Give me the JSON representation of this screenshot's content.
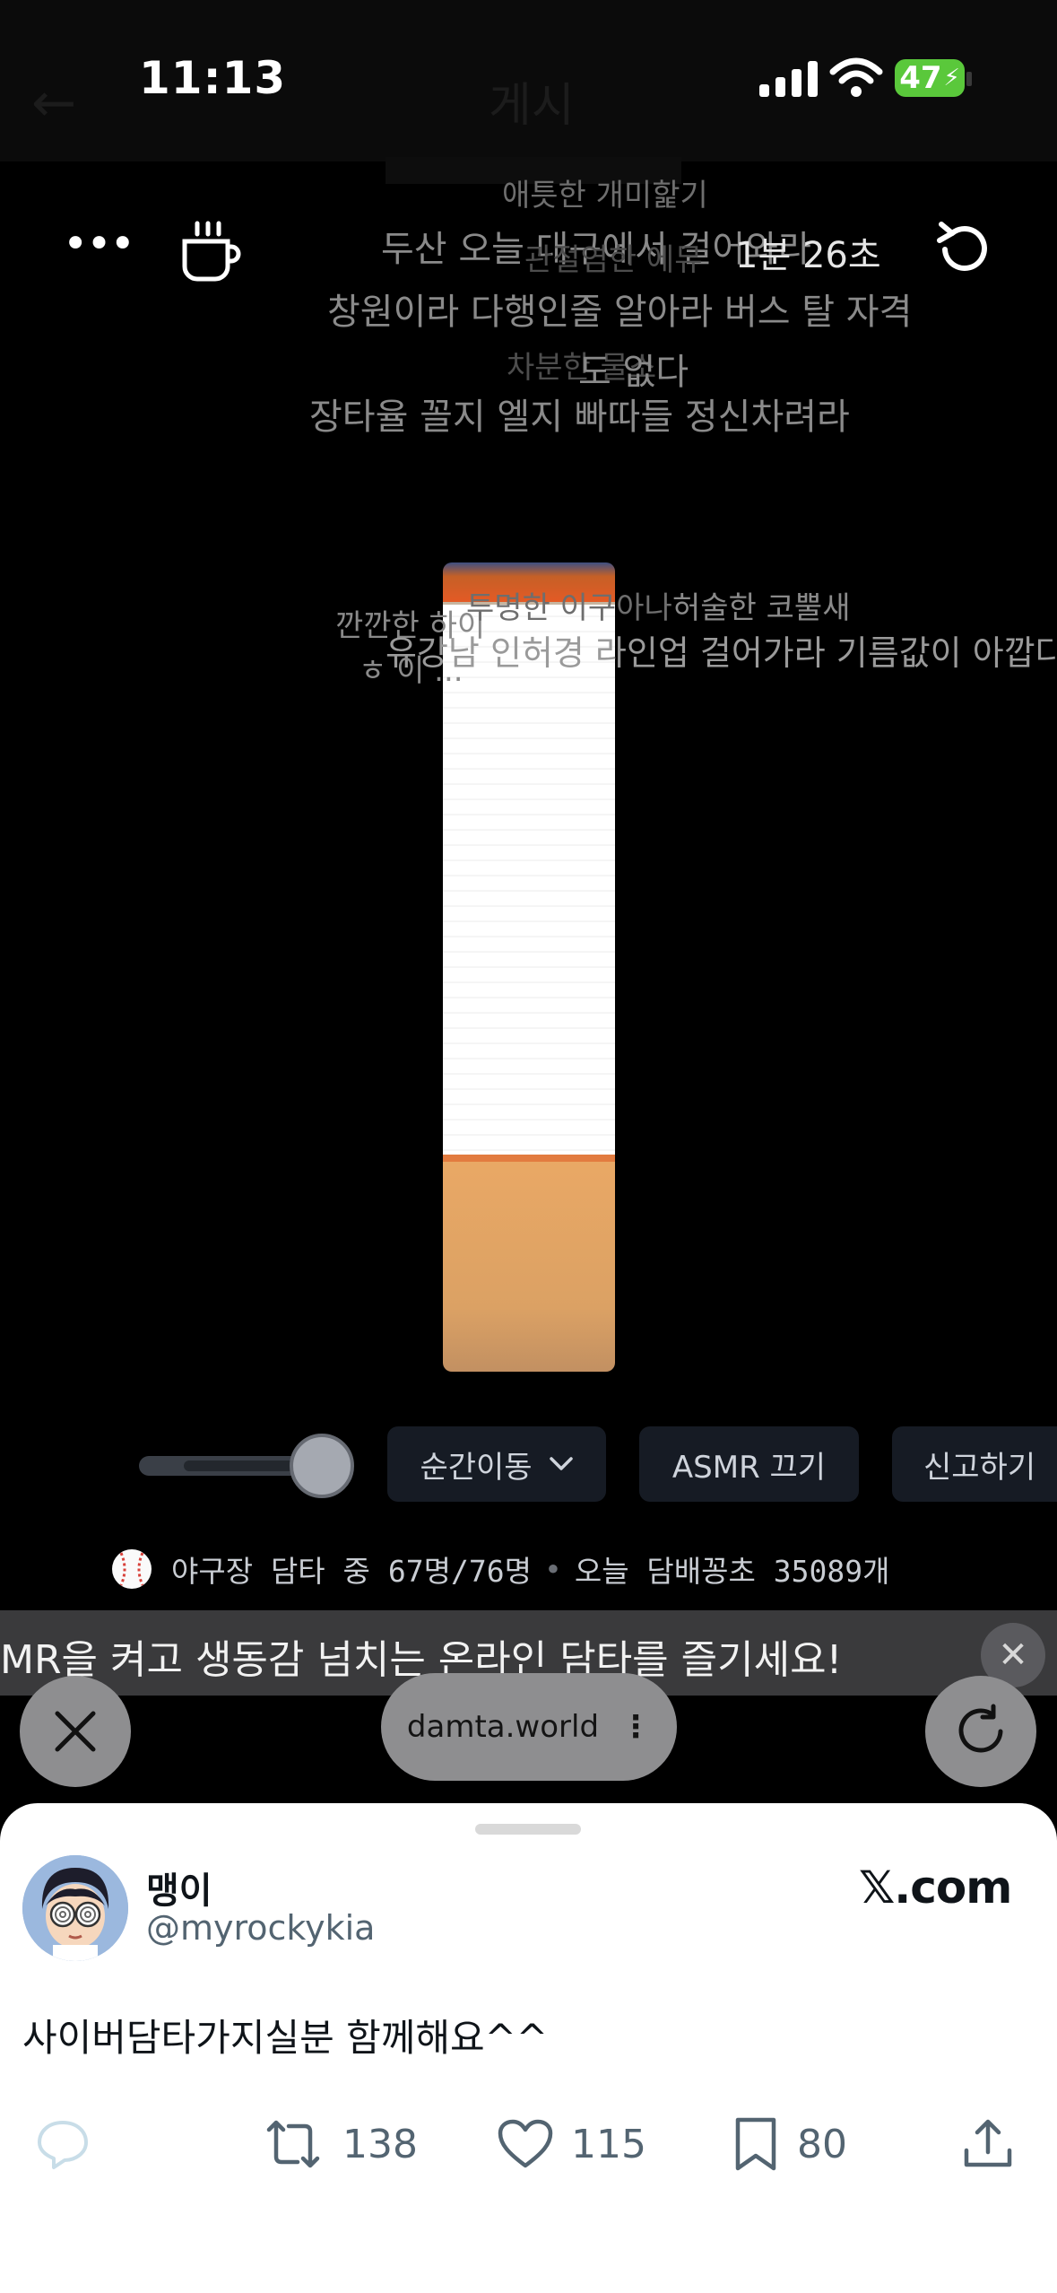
{
  "status_bar": {
    "time": "11:13",
    "battery_percent": "47",
    "ghost_title": "게시",
    "ghost_back": "←"
  },
  "toolbar": {
    "more_label": "•••",
    "timer": "1분  26초"
  },
  "messages": [
    "애틋한 개미핥기",
    "두산 오늘 대구에서 걸어와라",
    "관절염한 에뮤",
    "창원이라 다행인줄 알아라 버스 탈 자격",
    "차분한 물소",
    "도 없다",
    "장타율 꼴지 엘지 빠따들 정신차려라",
    "깐깐한 하이",
    "투명한 이구아나",
    "허술한 코뿔새",
    "유강남 인허경 라인업 걸어가라 기름값이 아깝다",
    "ㅎ 이 ..."
  ],
  "cigarette": {
    "remaining_fraction": 0.73
  },
  "controls": {
    "volume_level": 0.75,
    "teleport_label": "순간이동",
    "asmr_label": "ASMR 끄기",
    "report_label": "신고하기"
  },
  "info_bar": {
    "location_text": "야구장 담타 중",
    "users_text": "67명/76명",
    "separator": "•",
    "today_text": "오늘 담배꽁초 35089개"
  },
  "banner": {
    "text": "MR을 켜고 생동감 넘치는 온라인 담타를 즐기세요!",
    "close_label": "✕"
  },
  "browser": {
    "url": "damta.world",
    "kebab": "⋮"
  },
  "tweet": {
    "name": "맹이",
    "handle": "@myrockykia",
    "source": "𝕏.com",
    "text": "사이버담타가지실분 함께해요^^",
    "retweets": "138",
    "likes": "115",
    "bookmarks": "80"
  },
  "colors": {
    "accent_green": "#5ac83b",
    "filter_orange": "#e9a865",
    "sheet_bg": "#ffffff"
  }
}
